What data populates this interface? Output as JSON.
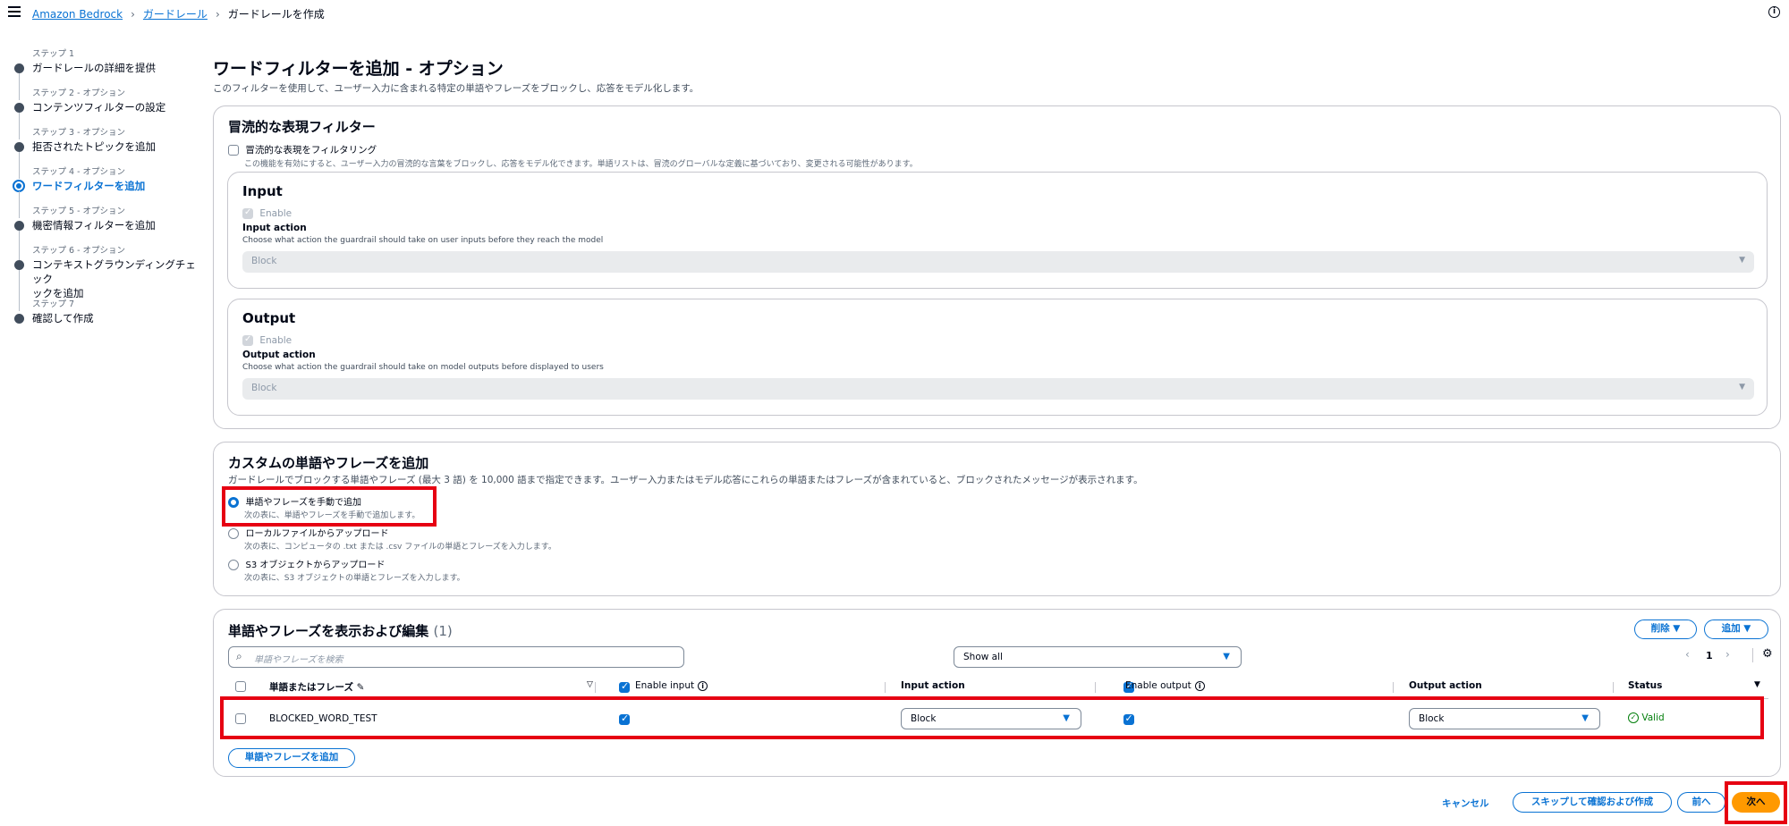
{
  "breadcrumb": [
    "Amazon Bedrock",
    "ガードレール",
    "ガードレールを作成"
  ],
  "steps": [
    {
      "label": "ステップ 1",
      "name": "ガードレールの詳細を提供"
    },
    {
      "label": "ステップ 2 - オプション",
      "name": "コンテンツフィルターの設定"
    },
    {
      "label": "ステップ 3 - オプション",
      "name": "拒否されたトピックを追加"
    },
    {
      "label": "ステップ 4 - オプション",
      "name": "ワードフィルターを追加"
    },
    {
      "label": "ステップ 5 - オプション",
      "name": "機密情報フィルターを追加"
    },
    {
      "label": "ステップ 6 - オプション",
      "name": "コンテキストグラウンディングチェック",
      "name2": "ックを追加"
    },
    {
      "label": "ステップ 7",
      "name": "確認して作成"
    }
  ],
  "page": {
    "title": "ワードフィルターを追加 - オプション",
    "desc": "このフィルターを使用して、ユーザー入力に含まれる特定の単語やフレーズをブロックし、応答をモデル化します。"
  },
  "profanity": {
    "title": "冒涜的な表現フィルター",
    "checkbox_label": "冒涜的な表現をフィルタリング",
    "checkbox_desc": "この機能を有効にすると、ユーザー入力の冒涜的な言葉をブロックし、応答をモデル化できます。単語リストは、冒涜のグローバルな定義に基づいており、変更される可能性があります。",
    "input": {
      "title": "Input",
      "enable": "Enable",
      "action_label": "Input action",
      "action_desc": "Choose what action the guardrail should take on user inputs before they reach the model",
      "value": "Block"
    },
    "output": {
      "title": "Output",
      "enable": "Enable",
      "action_label": "Output action",
      "action_desc": "Choose what action the guardrail should take on model outputs before displayed to users",
      "value": "Block"
    }
  },
  "custom": {
    "title": "カスタムの単語やフレーズを追加",
    "desc": "ガードレールでブロックする単語やフレーズ (最大 3 語) を 10,000 語まで指定できます。ユーザー入力またはモデル応答にこれらの単語またはフレーズが含まれていると、ブロックされたメッセージが表示されます。",
    "options": [
      {
        "label": "単語やフレーズを手動で追加",
        "desc": "次の表に、単語やフレーズを手動で追加します。"
      },
      {
        "label": "ローカルファイルからアップロード",
        "desc": "次の表に、コンピュータの .txt または .csv ファイルの単語とフレーズを入力します。"
      },
      {
        "label": "S3 オブジェクトからアップロード",
        "desc": "次の表に、S3 オブジェクトの単語とフレーズを入力します。"
      }
    ]
  },
  "table": {
    "title": "単語やフレーズを表示および編集",
    "count": "(1)",
    "delete_btn": "削除",
    "add_btn": "追加",
    "search_placeholder": "単語やフレーズを検索",
    "filter_value": "Show all",
    "page_num": "1",
    "columns": {
      "word": "単語またはフレーズ",
      "enable_input": "Enable input",
      "input_action": "Input action",
      "enable_output": "Enable output",
      "output_action": "Output action",
      "status": "Status"
    },
    "rows": [
      {
        "word": "BLOCKED_WORD_TEST",
        "input_action": "Block",
        "output_action": "Block",
        "status": "Valid"
      }
    ],
    "add_row_btn": "単語やフレーズを追加"
  },
  "footer": {
    "cancel": "キャンセル",
    "skip": "スキップして確認および作成",
    "prev": "前へ",
    "next": "次へ"
  },
  "colors": {
    "accent": "#0972d3",
    "primary": "#ff9900",
    "highlight": "#e60012",
    "success": "#037f0c"
  }
}
